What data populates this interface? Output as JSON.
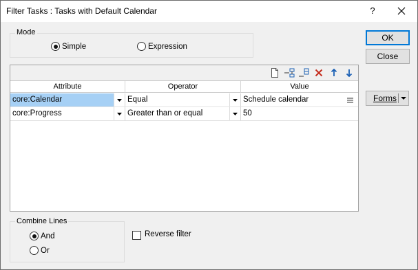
{
  "window": {
    "title": "Filter Tasks : Tasks with Default Calendar",
    "help_label": "?"
  },
  "mode": {
    "label": "Mode",
    "options": [
      {
        "label": "Simple",
        "selected": true
      },
      {
        "label": "Expression",
        "selected": false
      }
    ]
  },
  "buttons": {
    "ok": "OK",
    "close": "Close",
    "forms": "Forms"
  },
  "grid": {
    "headers": [
      "Attribute",
      "Operator",
      "Value"
    ],
    "rows": [
      {
        "attribute": "core:Calendar",
        "operator": "Equal",
        "value": "Schedule calendar",
        "selected": true
      },
      {
        "attribute": "core:Progress",
        "operator": "Greater than or equal",
        "value": "50",
        "selected": false
      }
    ],
    "toolbar_icons": [
      "new-row-icon",
      "insert-rows-icon",
      "append-rows-icon",
      "delete-icon",
      "move-up-icon",
      "move-down-icon"
    ]
  },
  "combine": {
    "label": "Combine Lines",
    "options": [
      {
        "label": "And",
        "selected": true
      },
      {
        "label": "Or",
        "selected": false
      }
    ]
  },
  "reverse_filter": {
    "label": "Reverse filter",
    "checked": false
  },
  "colors": {
    "accent": "#0078d7",
    "selection": "#a6d0f5",
    "delete_icon": "#c42b1c",
    "arrow_icon": "#1a5fb4"
  }
}
